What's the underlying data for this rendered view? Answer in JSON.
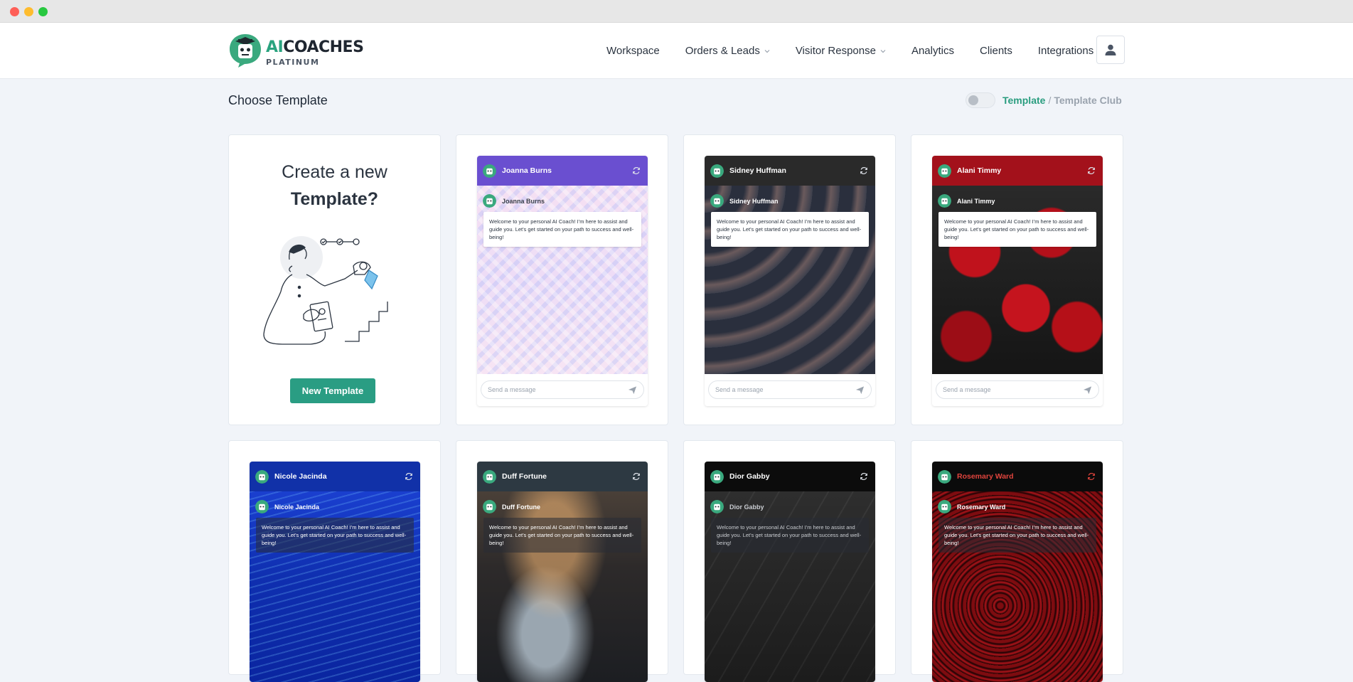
{
  "brand": {
    "ai": "AI",
    "name": "COACHES",
    "tier": "PLATINUM"
  },
  "nav": {
    "items": [
      {
        "label": "Workspace",
        "dropdown": false
      },
      {
        "label": "Orders & Leads",
        "dropdown": true
      },
      {
        "label": "Visitor Response",
        "dropdown": true
      },
      {
        "label": "Analytics",
        "dropdown": false
      },
      {
        "label": "Clients",
        "dropdown": false
      },
      {
        "label": "Integrations",
        "dropdown": false
      }
    ],
    "user_icon": "user-icon"
  },
  "page": {
    "title": "Choose Template",
    "toggle_on": false,
    "crumb_active": "Template",
    "crumb_sep": "/",
    "crumb_inactive": "Template Club"
  },
  "create": {
    "title_line1": "Create a new",
    "title_line2": "Template?",
    "button": "New Template"
  },
  "colors": {
    "accent": "#2a9d83",
    "page_bg": "#f1f4f9"
  },
  "templates": [
    {
      "name": "Joanna Burns",
      "header_color": "#6a4fd0",
      "theme": "pastel-cubes",
      "message": "Welcome to your personal AI Coach! I'm here to assist and guide you. Let's get started on your path to success and well-being!",
      "placeholder": "Send a message"
    },
    {
      "name": "Sidney Huffman",
      "header_color": "#2a2a2a",
      "theme": "dark-swirl",
      "message": "Welcome to your personal AI Coach! I'm here to assist and guide you. Let's get started on your path to success and well-being!",
      "placeholder": "Send a message"
    },
    {
      "name": "Alani Timmy",
      "header_color": "#a3111b",
      "theme": "red-roses",
      "message": "Welcome to your personal AI Coach! I'm here to assist and guide you. Let's get started on your path to success and well-being!",
      "placeholder": "Send a message"
    },
    {
      "name": "Nicole Jacinda",
      "header_color": "#1131a8",
      "theme": "blue-waves",
      "message": "Welcome to your personal AI Coach! I'm here to assist and guide you. Let's get started on your path to success and well-being!"
    },
    {
      "name": "Duff Fortune",
      "header_color": "#2d3942",
      "theme": "cloudy-sky",
      "message": "Welcome to your personal AI Coach! I'm here to assist and guide you. Let's get started on your path to success and well-being!"
    },
    {
      "name": "Dior Gabby",
      "header_color": "#0c0c0c",
      "theme": "dark-stone",
      "message": "Welcome to your personal AI Coach! I'm here to assist and guide you. Let's get started on your path to success and well-being!"
    },
    {
      "name": "Rosemary Ward",
      "header_color": "#0b0b0b",
      "theme": "red-fractal",
      "name_color": "#e0443d",
      "message": "Welcome to your personal AI Coach! I'm here to assist and guide you. Let's get started on your path to success and well-being!"
    }
  ]
}
